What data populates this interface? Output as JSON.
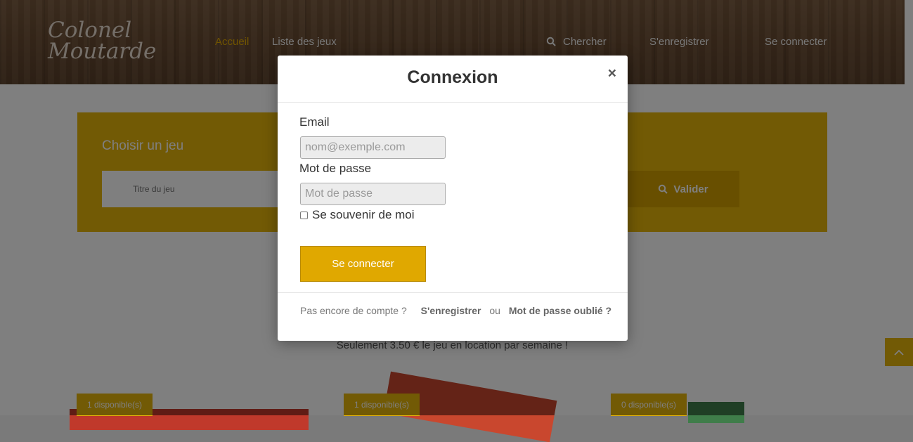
{
  "brand": {
    "logo_line1": "Colonel",
    "logo_line2": "Moutarde"
  },
  "nav": {
    "home": "Accueil",
    "games_list": "Liste des jeux",
    "search": "Chercher",
    "register": "S'enregistrer",
    "login": "Se connecter"
  },
  "search_panel": {
    "title": "Choisir un jeu",
    "title_placeholder": "Titre du jeu",
    "validate": "Valider"
  },
  "tagline": "Seulement 3.50 € le jeu en location par semaine !",
  "games": [
    {
      "badge": "1 disponible(s)"
    },
    {
      "badge": "1 disponible(s)"
    },
    {
      "badge": "0 disponible(s)"
    }
  ],
  "modal": {
    "title": "Connexion",
    "close": "×",
    "email_label": "Email",
    "email_placeholder": "nom@exemple.com",
    "password_label": "Mot de passe",
    "password_placeholder": "Mot de passe",
    "remember_label": "Se souvenir de moi",
    "submit": "Se connecter",
    "footer_text": "Pas encore de compte ?",
    "footer_register": "S'enregistrer",
    "footer_or": "ou",
    "footer_forgot": "Mot de passe oublié ?"
  },
  "colors": {
    "accent": "#e5b50a",
    "accent_dark": "#d19f00",
    "active_nav": "#e0a800"
  }
}
